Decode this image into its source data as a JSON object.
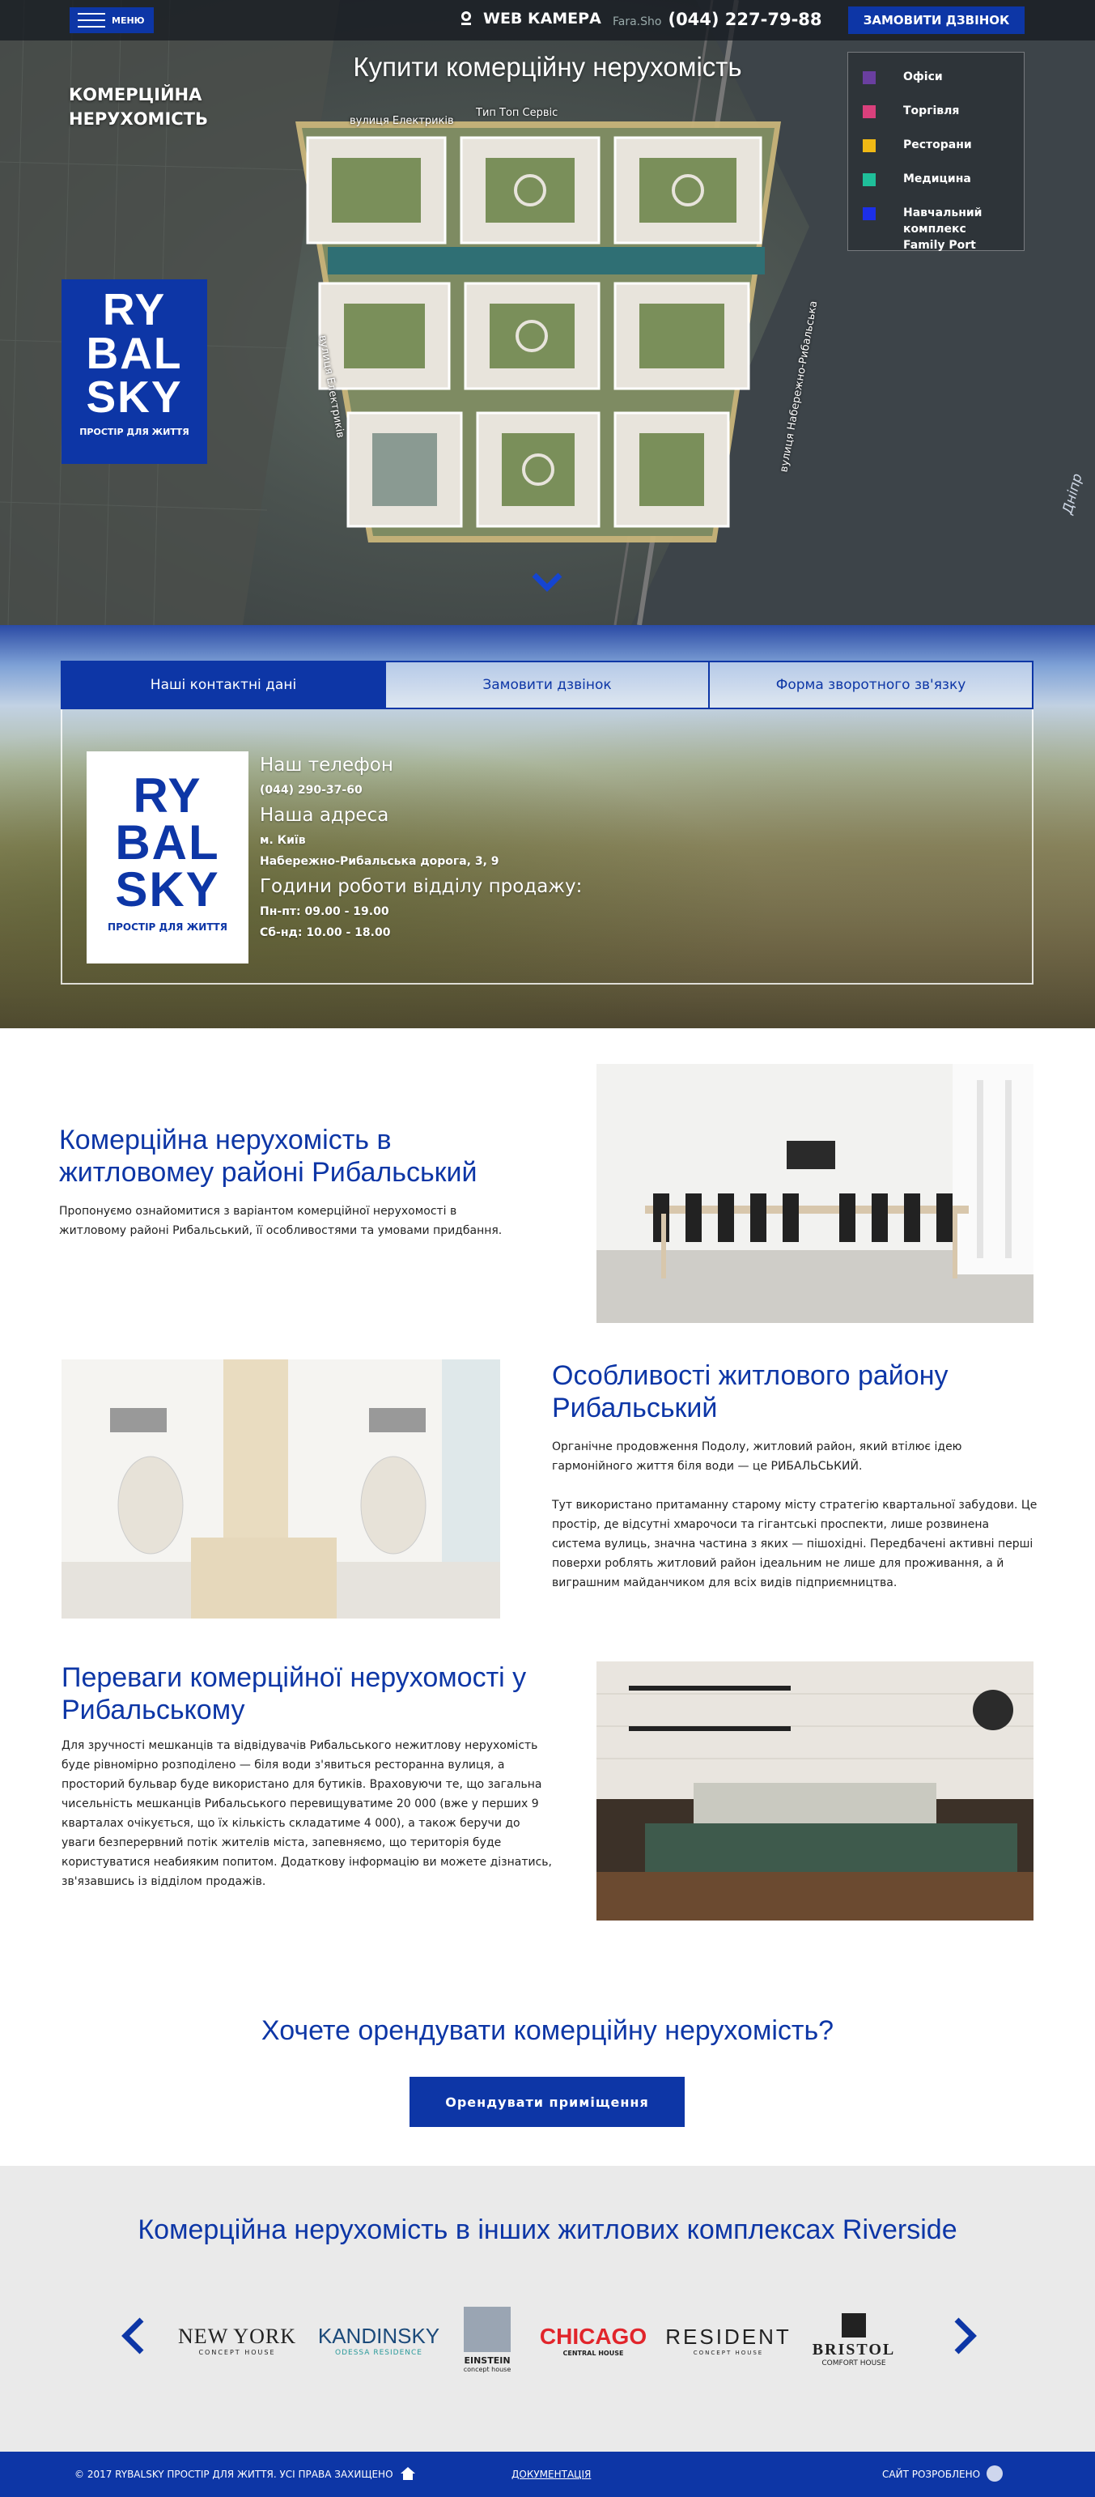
{
  "header": {
    "menu_label": "МЕНЮ",
    "webcam_label": "WEB КАМЕРА",
    "phone_prefix": "Fara.Sho",
    "phone": "(044) 227-79-88",
    "call_button": "ЗАМОВИТИ ДЗВІНОК"
  },
  "hero": {
    "title": "Купити комерційну нерухомість",
    "subtitle_line1": "КОМЕРЦІЙНА",
    "subtitle_line2": "НЕРУХОМІСТЬ",
    "streets": {
      "electrikiv": "вулиця Електриків",
      "tip_top": "Тип Топ Сервіс",
      "electrikiv_vertical": "вулиця Електриків",
      "naberezhno": "вулиця Набережно-Рибальська",
      "river": "Дніпр"
    },
    "legend": [
      {
        "label": "Офіси",
        "color": "#6a3fa0"
      },
      {
        "label": "Торгівля",
        "color": "#d9407c"
      },
      {
        "label": "Ресторани",
        "color": "#f0b915"
      },
      {
        "label": "Медицина",
        "color": "#1fbf9a"
      },
      {
        "label": "Навчальний комплекс Family Port",
        "color": "#1c2fe8"
      }
    ]
  },
  "logo": {
    "line1": "RY",
    "line2": "BAL",
    "line3": "SKY",
    "tagline": "ПРОСТІР ДЛЯ ЖИТТЯ"
  },
  "contact": {
    "tabs": [
      "Наші контактні дані",
      "Замовити дзвінок",
      "Форма зворотного зв'язку"
    ],
    "phone_heading": "Наш телефон",
    "phone": "(044) 290-37-60",
    "address_heading": "Наша адреса",
    "city": "м. Київ",
    "street": "Набережно-Рибальська дорога, 3, 9",
    "hours_heading": "Години роботи відділу продажу:",
    "hours_weekdays": "Пн-пт: 09.00 - 19.00",
    "hours_weekend": "Сб-нд: 10.00 - 18.00"
  },
  "sections": {
    "s1": {
      "title": "Комерційна нерухомість в житловомеу районі Рибальський",
      "text": "Пропонуємо ознайомитися з варіантом комерційної нерухомості в житловому районі Рибальський, її особливостями та умовами придбання."
    },
    "s2": {
      "title": "Особливості житлового району Рибальський",
      "text1": "Органічне продовження Подолу, житловий район, який втілює ідею гармонійного життя біля води — це РИБАЛЬСЬКИЙ.",
      "text2": "Тут використано притаманну старому місту стратегію квартальної забудови. Це простір, де відсутні хмарочоси та гігантські проспекти, лише розвинена система вулиць, значна частина з яких — пішохідні. Передбачені активні перші поверхи роблять житловий район ідеальним не лише для проживання, а й виграшним майданчиком для всіх видів підприємництва."
    },
    "s3": {
      "title": "Переваги комерційної нерухомості у Рибальському",
      "text": "Для зручності мешканців та відвідувачів Рибальського нежитлову нерухомість буде рівномірно розподілено — біля води з'явиться ресторанна вулиця, а просторий бульвар буде використано для бутиків. Враховуючи те, що загальна чисельність мешканців Рибальського перевищуватиме 20 000 (вже у перших 9 кварталах очікується, що їх кількість складатиме 4 000), а також беручи до уваги безперервний потік жителів міста, запевняємо, що територія буде користуватися неабияким попитом. Додаткову інформацію ви можете дізнатись, зв'язавшись із відділом продажів."
    }
  },
  "cta": {
    "title": "Хочете орендувати комерційну нерухомість?",
    "button": "Орендувати приміщення"
  },
  "partners": {
    "title": "Комерційна нерухомість в інших житлових комплексах Riverside",
    "items": [
      {
        "name": "NEW YORK",
        "sub": "CONCEPT HOUSE"
      },
      {
        "name": "KANDINSKY",
        "sub": "ODESSA RESIDENCE"
      },
      {
        "name": "EINSTEIN",
        "sub": "concept house"
      },
      {
        "name": "CHICAGO",
        "sub": "CENTRAL HOUSE"
      },
      {
        "name": "RESIDENT",
        "sub": "CONCEPT HOUSE"
      },
      {
        "name": "BRISTOL",
        "sub": "COMFORT HOUSE"
      }
    ]
  },
  "footer": {
    "copyright": "© 2017 RYBALSKY ПРОСТІР ДЛЯ ЖИТТЯ. УСІ ПРАВА ЗАХИЩЕНО",
    "docs": "ДОКУМЕНТАЦІЯ",
    "developer": "САЙТ РОЗРОБЛЕНО"
  }
}
